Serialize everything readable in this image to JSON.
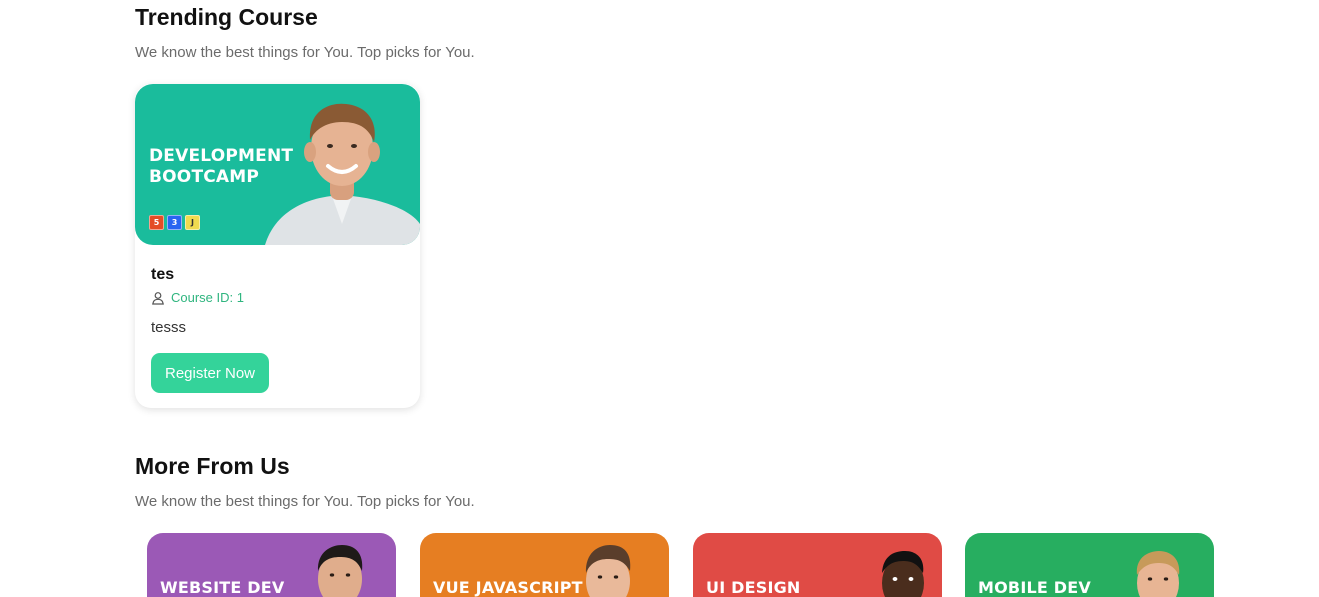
{
  "trending": {
    "title": "Trending Course",
    "subtitle": "We know the best things for You. Top picks for You.",
    "card": {
      "thumb_title": "DEVELOPMENT BOOTCAMP",
      "thumb_color": "#1abc9c",
      "tech_icons": [
        "html5-icon",
        "css3-icon",
        "js-icon"
      ],
      "tech_labels": [
        "5",
        "3",
        "J"
      ],
      "name": "tes",
      "id_label": "Course ID: 1",
      "description": "tesss",
      "button_label": "Register Now",
      "button_color": "#34d39a"
    }
  },
  "more": {
    "title": "More From Us",
    "subtitle": "We know the best things for You. Top picks for You.",
    "cards": [
      {
        "label": "WEBSITE DEV",
        "color": "#9b59b6"
      },
      {
        "label": "VUE JAVASCRIPT",
        "color": "#e67e22"
      },
      {
        "label": "UI DESIGN",
        "color": "#e04b45"
      },
      {
        "label": "MOBILE DEV",
        "color": "#27ae60"
      }
    ]
  }
}
